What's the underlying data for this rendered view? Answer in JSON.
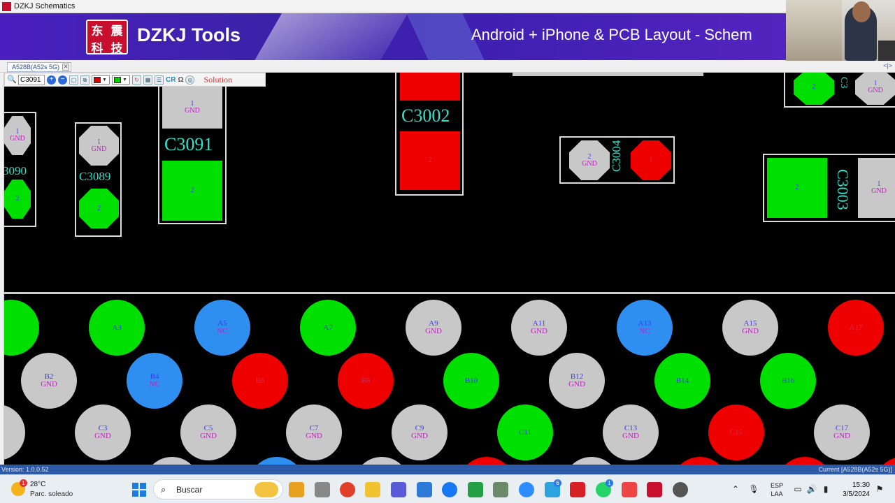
{
  "window": {
    "title": "DZKJ Schematics"
  },
  "banner": {
    "logo_chars": [
      "东",
      "震",
      "科",
      "技"
    ],
    "brand": "DZKJ Tools",
    "tagline": "Android + iPhone & PCB Layout - Schem"
  },
  "tabs": [
    {
      "label": "A528B(A52s 5G)",
      "close": "✕"
    }
  ],
  "tab_nav": "<|>",
  "toolbar": {
    "search_icon": "🔍",
    "search_value": "C3091",
    "text_tool": "CR",
    "omega": "Ω",
    "solution": "Solution",
    "colors": {
      "fill_1": "#dd0000",
      "fill_2": "#00cc00"
    }
  },
  "components": [
    {
      "designator": "3090",
      "pads": [
        {
          "num": "1",
          "net": "GND",
          "color": "gray"
        },
        {
          "num": "2",
          "net": "",
          "color": "green"
        }
      ]
    },
    {
      "designator": "C3089",
      "pads": [
        {
          "num": "1",
          "net": "GND",
          "color": "gray"
        },
        {
          "num": "2",
          "net": "",
          "color": "green"
        }
      ]
    },
    {
      "designator": "C3091",
      "pads": [
        {
          "num": "1",
          "net": "GND",
          "color": "gray"
        },
        {
          "num": "2",
          "net": "",
          "color": "green"
        }
      ]
    },
    {
      "designator": "C3002",
      "pads": [
        {
          "num": "",
          "net": "",
          "color": "red"
        },
        {
          "num": "2",
          "net": "",
          "color": "red"
        }
      ]
    },
    {
      "designator": "C3004",
      "pads": [
        {
          "num": "2",
          "net": "GND",
          "color": "gray"
        },
        {
          "num": "1",
          "net": "",
          "color": "red"
        }
      ]
    },
    {
      "designator": "C3003",
      "pads": [
        {
          "num": "2",
          "net": "",
          "color": "green"
        },
        {
          "num": "1",
          "net": "GND",
          "color": "gray"
        }
      ]
    },
    {
      "designator": "C3",
      "pads": [
        {
          "num": "2",
          "net": "",
          "color": "green"
        },
        {
          "num": "1",
          "net": "GND",
          "color": "gray"
        }
      ]
    }
  ],
  "bga_rows": [
    [
      {
        "id": "",
        "net": "",
        "color": "green"
      },
      {
        "id": "A3",
        "net": "",
        "color": "green"
      },
      {
        "id": "A5",
        "net": "NC",
        "color": "blue"
      },
      {
        "id": "A7",
        "net": "",
        "color": "green"
      },
      {
        "id": "A9",
        "net": "GND",
        "color": "gray"
      },
      {
        "id": "A11",
        "net": "GND",
        "color": "gray"
      },
      {
        "id": "A13",
        "net": "NC",
        "color": "blue"
      },
      {
        "id": "A15",
        "net": "GND",
        "color": "gray"
      },
      {
        "id": "A17",
        "net": "",
        "color": "red"
      }
    ],
    [
      {
        "id": "B2",
        "net": "GND",
        "color": "gray"
      },
      {
        "id": "B4",
        "net": "NC",
        "color": "blue"
      },
      {
        "id": "B6",
        "net": "",
        "color": "red"
      },
      {
        "id": "B8",
        "net": "",
        "color": "red"
      },
      {
        "id": "B10",
        "net": "",
        "color": "green"
      },
      {
        "id": "B12",
        "net": "GND",
        "color": "gray"
      },
      {
        "id": "B14",
        "net": "",
        "color": "green"
      },
      {
        "id": "B16",
        "net": "",
        "color": "green"
      }
    ],
    [
      {
        "id": "",
        "net": "",
        "color": "gray"
      },
      {
        "id": "C3",
        "net": "GND",
        "color": "gray"
      },
      {
        "id": "C5",
        "net": "GND",
        "color": "gray"
      },
      {
        "id": "C7",
        "net": "GND",
        "color": "gray"
      },
      {
        "id": "C9",
        "net": "GND",
        "color": "gray"
      },
      {
        "id": "C11",
        "net": "",
        "color": "green"
      },
      {
        "id": "C13",
        "net": "GND",
        "color": "gray"
      },
      {
        "id": "C15",
        "net": "",
        "color": "red"
      },
      {
        "id": "C17",
        "net": "GND",
        "color": "gray"
      }
    ]
  ],
  "statusbar": {
    "version": "Version: 1.0.0.52",
    "current": "Current [A528B(A52s 5G)]"
  },
  "taskbar": {
    "weather_temp": "28°C",
    "weather_desc": "Parc. soleado",
    "weather_badge": "1",
    "search_label": "Buscar",
    "lang_1": "ESP",
    "lang_2": "LAA",
    "time": "15:30",
    "date": "3/5/2024",
    "telegram_badge": "6",
    "whatsapp_badge": "1"
  }
}
